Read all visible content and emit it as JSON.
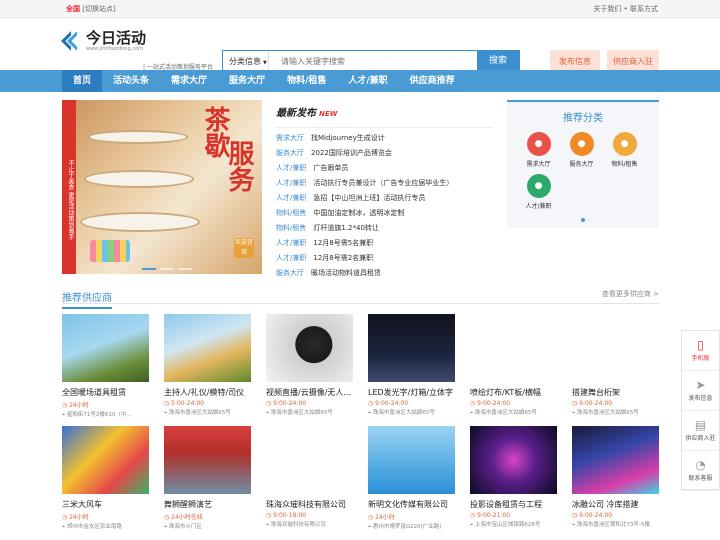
{
  "topbar": {
    "location": "全国",
    "switch": "[切换站点]",
    "right": "关于我们 • 联系方式"
  },
  "logo": {
    "name": "今日活动",
    "url": "www.jinrihuodong.com",
    "slogan": "| 一站式活动策划服务平台"
  },
  "search": {
    "category": "分类信息",
    "placeholder": "请输入关键字搜索",
    "button": "搜索"
  },
  "header_buttons": {
    "publish": "发布信息",
    "join": "供应商入驻"
  },
  "nav": [
    "首页",
    "活动头条",
    "需求大厅",
    "服务大厅",
    "物料/租售",
    "人才/兼职",
    "供应商推荐"
  ],
  "banner": {
    "strip": "不止于美食 更是活动策划高手",
    "title_a": "茶歇",
    "title_b": "服务",
    "badge": "欢迎咨询"
  },
  "news": {
    "title": "最新发布",
    "new_tag": "NEW",
    "items": [
      {
        "tag": "需求大厅",
        "text": "找Midjourney生成设计"
      },
      {
        "tag": "服务大厅",
        "text": "2022国际培训产品博览会"
      },
      {
        "tag": "人才/兼职",
        "text": "广告跟单员"
      },
      {
        "tag": "人才/兼职",
        "text": "活动执行专员兼设计（广告专业应届毕业生）"
      },
      {
        "tag": "人才/兼职",
        "text": "急招【中山坦洲上班】活动执行专员"
      },
      {
        "tag": "物料/租售",
        "text": "中国加油定制冰，透明冰定制"
      },
      {
        "tag": "物料/租售",
        "text": "灯杆道旗1.2*40转让"
      },
      {
        "tag": "人才/兼职",
        "text": "12月8号需5名兼职"
      },
      {
        "tag": "人才/兼职",
        "text": "12月8号需2名兼职"
      },
      {
        "tag": "服务大厅",
        "text": "暖场活动物料道具租赁"
      }
    ]
  },
  "recommend": {
    "title": "推荐分类",
    "items": [
      {
        "label": "需求大厅",
        "icon": "megaphone-icon",
        "color": "#e8524a"
      },
      {
        "label": "服务大厅",
        "icon": "person-icon",
        "color": "#f08a24"
      },
      {
        "label": "物料/租售",
        "icon": "box-icon",
        "color": "#f0a93a"
      },
      {
        "label": "人才/兼职",
        "icon": "id-card-icon",
        "color": "#2fa86b"
      }
    ]
  },
  "suppliers": {
    "title": "推荐供应商",
    "more": "查看更多供应商 >",
    "cards": [
      {
        "name": "全国暖场道具租赁",
        "hours": "24小时",
        "addr": "星和街71号2楼610（中...",
        "bg": "linear-gradient(160deg,#7fc3ea 0%,#a7d8ef 45%,#6b8f3a 75%,#3f5e22 100%)"
      },
      {
        "name": "主持人/礼仪/模特/司仪",
        "hours": "5:00-24:00",
        "addr": "珠海市香洲区大姑娘65号",
        "bg": "linear-gradient(160deg,#8ec9ec 0%,#cfe6f2 40%,#e3b55e 65%,#5a8a2c 100%)"
      },
      {
        "name": "视频直播/云摄像/无人...",
        "hours": "9:00-24:00",
        "addr": "珠海市香洲区大姑娘65号",
        "bg": "radial-gradient(circle at 55% 45%,#2a2a2a 0%,#1b1b1b 30%,#cfcfcf 31%,#f3f3f3 100%)"
      },
      {
        "name": "LED发光字/灯箱/立体字",
        "hours": "9:00-24:00",
        "addr": "珠海市香洲区大姑娘65号",
        "bg": "linear-gradient(180deg,#10131c 0%,#1c2540 60%,#3d4a6e 100%)"
      },
      {
        "name": "喷绘灯布/KT板/横幅",
        "hours": "9:00-24:00",
        "addr": "珠海市香洲区大姑娘65号",
        "bg": "linear-gradient(135deg,#ffffff 0%,#ffffff 100%)"
      },
      {
        "name": "搭建舞台桁架",
        "hours": "9:00-24:00",
        "addr": "珠海市香洲区大姑娘65号",
        "bg": "linear-gradient(180deg,#ffffff 0%,#ffffff 100%)"
      },
      {
        "name": "三米大风车",
        "hours": "24小时",
        "addr": "郑州市金水区农业南路",
        "bg": "linear-gradient(135deg,#3b6fd4 0%,#f2c230 40%,#e54848 70%,#3bb36a 100%)"
      },
      {
        "name": "舞狮醒狮演艺",
        "hours": "24小时在线",
        "addr": "珠海市斗门区",
        "bg": "linear-gradient(180deg,#d94040 0%,#b0302a 40%,#6e8fa6 100%)"
      },
      {
        "name": "珠海众璀科技有限公司",
        "hours": "9:00-18:00",
        "addr": "珠海众璀科技有限公司",
        "bg": "linear-gradient(180deg,#ffffff 0%,#ffffff 100%)"
      },
      {
        "name": "新明文化传媒有限公司",
        "hours": "24小时",
        "addr": "惠州市博罗县G220(广汕路)",
        "bg": "linear-gradient(180deg,#9dd3f2 0%,#5fb2e6 50%,#2c8fd6 100%)"
      },
      {
        "name": "投影设备租赁与工程",
        "hours": "9:00-21:00",
        "addr": "上海市宝山区城银路628号",
        "bg": "radial-gradient(circle at 50% 50%,#d845c8 0%,#5a1f8a 40%,#0b0b22 100%)"
      },
      {
        "name": "冰雕公司 冷库搭建",
        "hours": "9:00-24:00",
        "addr": "珠海市香洲区翠和北73号-5楼",
        "bg": "linear-gradient(160deg,#1a1a3a 0%,#3546a8 40%,#d83fa8 75%,#3bd6e8 100%)"
      }
    ]
  },
  "sidebar": [
    {
      "label": "手机版",
      "icon": "phone-icon"
    },
    {
      "label": "发布信息",
      "icon": "send-icon"
    },
    {
      "label": "供应商入驻",
      "icon": "shop-icon"
    },
    {
      "label": "联系客服",
      "icon": "chat-icon"
    }
  ]
}
